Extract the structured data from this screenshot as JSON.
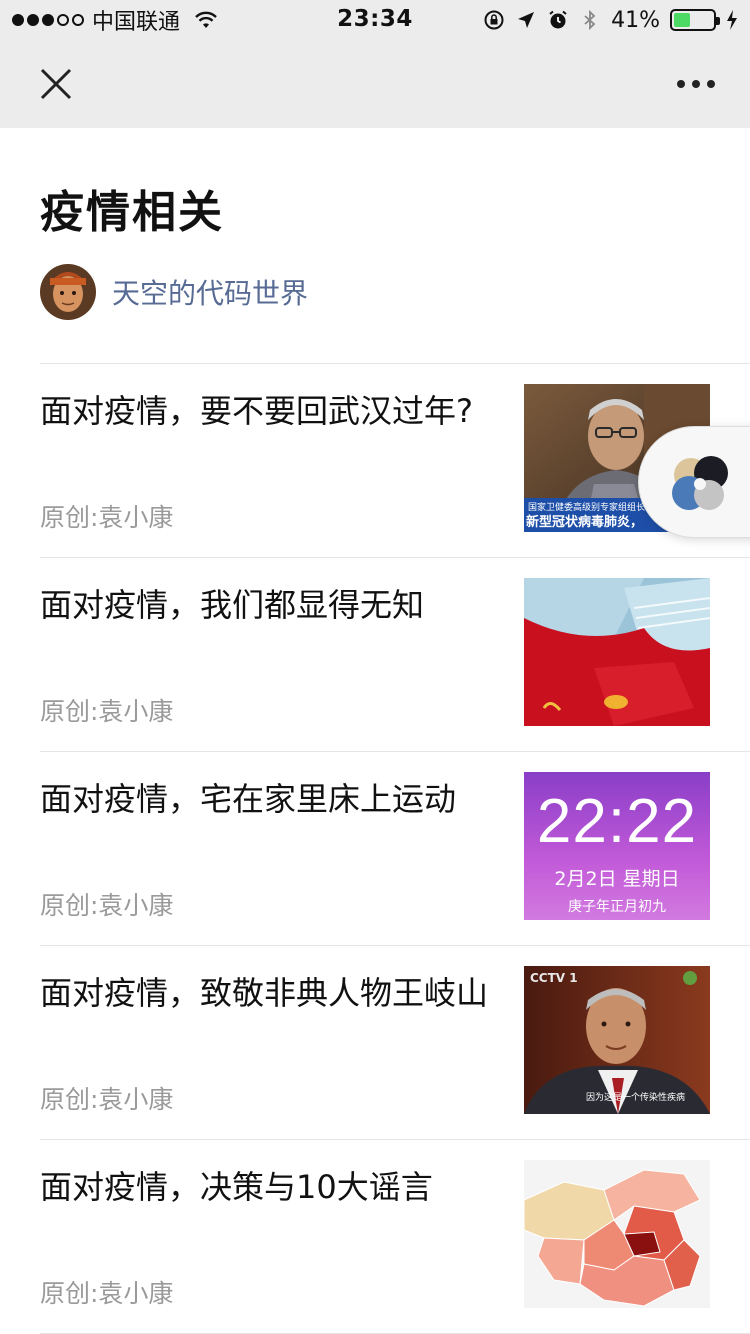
{
  "status_bar": {
    "carrier": "中国联通",
    "time": "23:34",
    "battery_percent": "41%",
    "battery_level": 0.41,
    "battery_color": "#4cd964"
  },
  "nav": {
    "close_icon": "close-icon",
    "more_icon": "more-icon"
  },
  "album": {
    "title": "疫情相关",
    "author": "天空的代码世界",
    "author_color": "#576b95"
  },
  "articles": [
    {
      "title": "面对疫情，要不要回武汉过年?",
      "meta": "原创:袁小康",
      "thumb_caption_1": "国家卫健委高级别专家组组长",
      "thumb_caption_2": "新型冠状病毒肺炎，"
    },
    {
      "title": "面对疫情，我们都显得无知",
      "meta": "原创:袁小康"
    },
    {
      "title": "面对疫情，宅在家里床上运动",
      "meta": "原创:袁小康",
      "thumb_time": "22:22",
      "thumb_date": "2月2日 星期日",
      "thumb_lunar": "庚子年正月初九"
    },
    {
      "title": "面对疫情，致敬非典人物王岐山",
      "meta": "原创:袁小康",
      "thumb_caption": "因为这是一个传染性疾病",
      "thumb_logo": "CCTV 1"
    },
    {
      "title": "面对疫情，决策与10大谣言",
      "meta": "原创:袁小康"
    }
  ]
}
